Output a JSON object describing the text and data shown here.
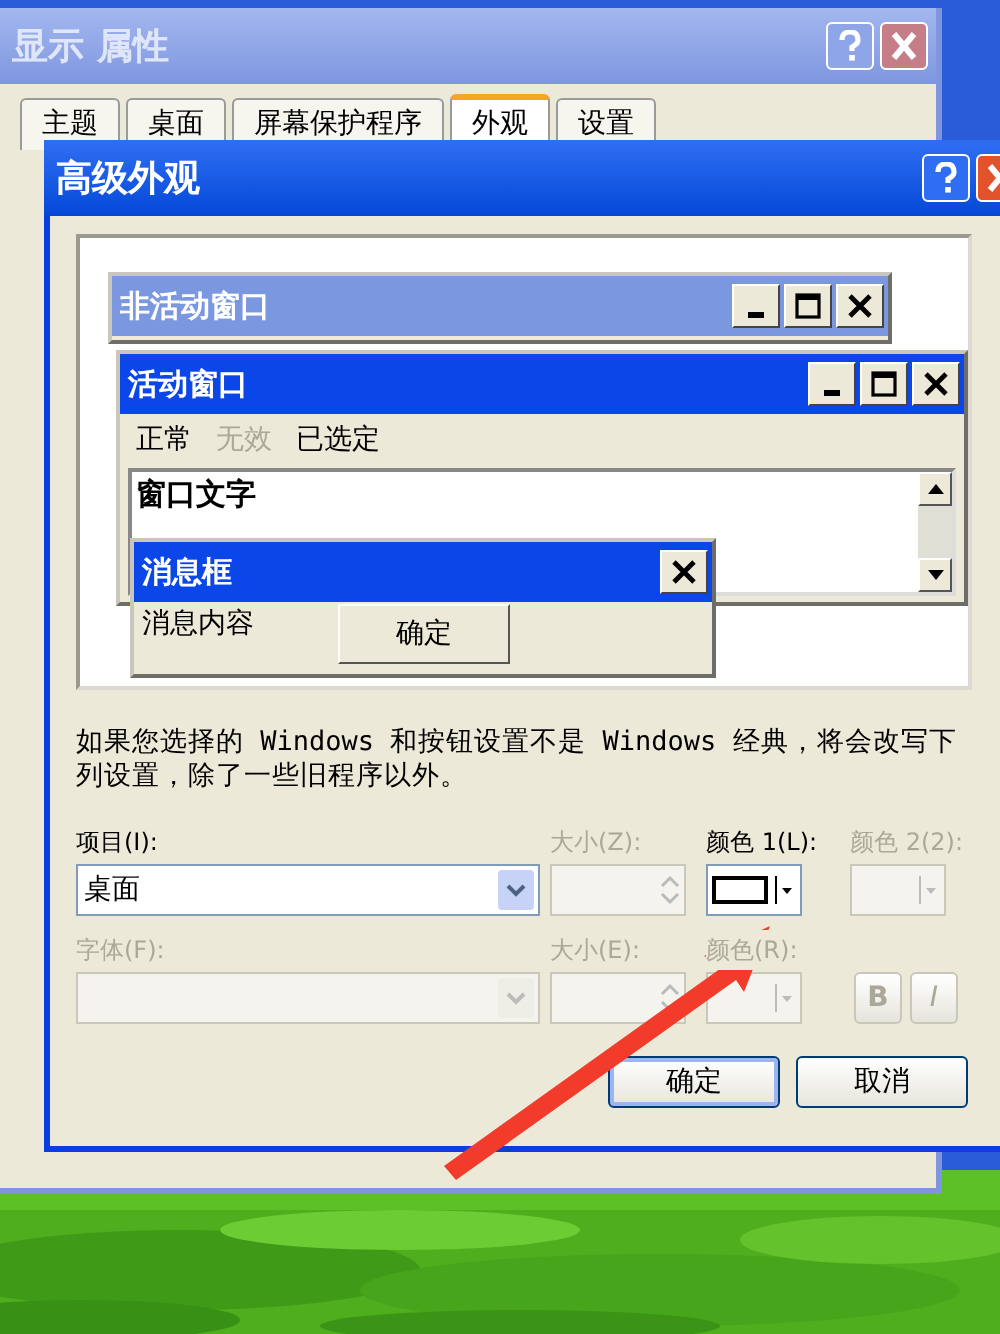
{
  "back_window": {
    "title": "显示 属性",
    "tabs": [
      {
        "label": "主题",
        "selected": false
      },
      {
        "label": "桌面",
        "selected": false
      },
      {
        "label": "屏幕保护程序",
        "selected": false
      },
      {
        "label": "外观",
        "selected": true
      },
      {
        "label": "设置",
        "selected": false
      }
    ]
  },
  "dialog": {
    "title": "高级外观",
    "preview": {
      "inactive_window": {
        "title": "非活动窗口"
      },
      "active_window": {
        "title": "活动窗口",
        "menu": [
          {
            "label": "正常",
            "disabled": false
          },
          {
            "label": "无效",
            "disabled": true
          },
          {
            "label": "已选定",
            "disabled": false
          }
        ],
        "text": "窗口文字"
      },
      "message_box": {
        "title": "消息框",
        "message": "消息内容",
        "button": "确定"
      }
    },
    "description": "如果您选择的 Windows 和按钮设置不是 Windows 经典，将会改写下列设置，除了一些旧程序以外。",
    "row_1": [
      {
        "kind": "combo",
        "label": "项目(I):",
        "value": "桌面",
        "disabled": false
      },
      {
        "kind": "spin",
        "label": "大小(Z):",
        "disabled": true
      },
      {
        "kind": "color",
        "label": "颜色 1(L):",
        "color": "#ffffff",
        "disabled": false
      },
      {
        "kind": "color",
        "label": "颜色 2(2):",
        "disabled": true
      }
    ],
    "row_2": [
      {
        "kind": "combo",
        "label": "字体(F):",
        "disabled": true
      },
      {
        "kind": "spin",
        "label": "大小(E):",
        "disabled": true
      },
      {
        "kind": "color",
        "label": "颜色(R):",
        "disabled": true
      },
      {
        "kind": "style",
        "label": "B",
        "disabled": true
      },
      {
        "kind": "style",
        "label": "I",
        "disabled": true
      }
    ],
    "buttons": [
      "确定",
      "取消"
    ]
  }
}
